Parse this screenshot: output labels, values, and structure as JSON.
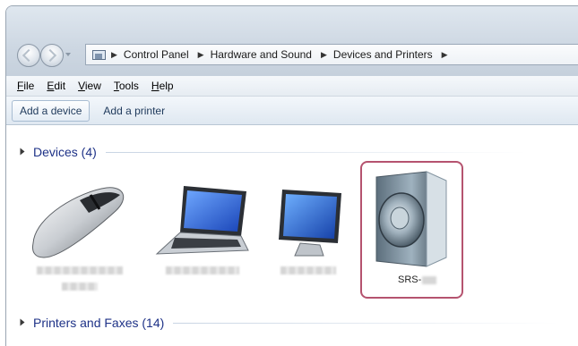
{
  "breadcrumb": {
    "items": [
      "Control Panel",
      "Hardware and Sound",
      "Devices and Printers"
    ]
  },
  "menu": [
    "File",
    "Edit",
    "View",
    "Tools",
    "Help"
  ],
  "commands": {
    "add_device": "Add a device",
    "add_printer": "Add a printer"
  },
  "groups": {
    "devices": "Devices (4)",
    "printers": "Printers and Faxes (14)"
  },
  "devices": [
    {
      "icon": "mouse-icon",
      "name": ""
    },
    {
      "icon": "laptop-icon",
      "name": ""
    },
    {
      "icon": "monitor-icon",
      "name": ""
    },
    {
      "icon": "speaker-icon",
      "name": "SRS-",
      "selected": true
    }
  ],
  "colors": {
    "selection_border": "#b5536f",
    "group_header": "#1e3287"
  }
}
